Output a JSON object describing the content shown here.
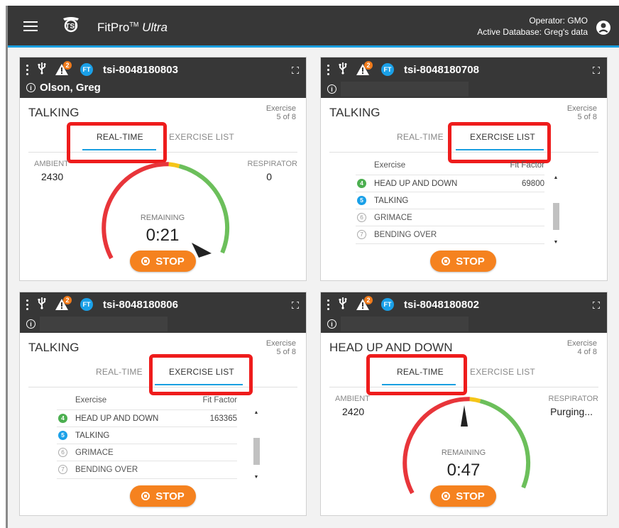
{
  "app": {
    "title": "FitPro",
    "tm": "TM",
    "edition": "Ultra",
    "operator_line": "Operator: GMO",
    "database_line": "Active Database: Greg's data"
  },
  "cards": [
    {
      "device": "tsi-8048180803",
      "alert_count": "2",
      "ft_label": "FT",
      "person": "Olson, Greg",
      "exercise": "TALKING",
      "exercise_label": "Exercise",
      "exercise_count": "5 of 8",
      "tab_realtime": "REAL-TIME",
      "tab_list": "EXERCISE LIST",
      "active_tab": "REAL-TIME",
      "ambient_label": "AMBIENT",
      "ambient": "2430",
      "respirator_label": "RESPIRATOR",
      "respirator": "0",
      "remaining_label": "REMAINING",
      "remaining": "0:21",
      "stop_label": "STOP"
    },
    {
      "device": "tsi-8048180708",
      "alert_count": "2",
      "ft_label": "FT",
      "person": "",
      "exercise": "TALKING",
      "exercise_label": "Exercise",
      "exercise_count": "5 of 8",
      "tab_realtime": "REAL-TIME",
      "tab_list": "EXERCISE LIST",
      "active_tab": "EXERCISE LIST",
      "list_col_exercise": "Exercise",
      "list_col_fit": "Fit Factor",
      "list": [
        {
          "n": "4",
          "name": "HEAD UP AND DOWN",
          "fit": "69800",
          "state": "done"
        },
        {
          "n": "5",
          "name": "TALKING",
          "fit": "",
          "state": "current"
        },
        {
          "n": "6",
          "name": "GRIMACE",
          "fit": "",
          "state": "pending"
        },
        {
          "n": "7",
          "name": "BENDING OVER",
          "fit": "",
          "state": "pending"
        }
      ],
      "stop_label": "STOP"
    },
    {
      "device": "tsi-8048180806",
      "alert_count": "2",
      "ft_label": "FT",
      "person": "",
      "exercise": "TALKING",
      "exercise_label": "Exercise",
      "exercise_count": "5 of 8",
      "tab_realtime": "REAL-TIME",
      "tab_list": "EXERCISE LIST",
      "active_tab": "EXERCISE LIST",
      "list_col_exercise": "Exercise",
      "list_col_fit": "Fit Factor",
      "list": [
        {
          "n": "4",
          "name": "HEAD UP AND DOWN",
          "fit": "163365",
          "state": "done"
        },
        {
          "n": "5",
          "name": "TALKING",
          "fit": "",
          "state": "current"
        },
        {
          "n": "6",
          "name": "GRIMACE",
          "fit": "",
          "state": "pending"
        },
        {
          "n": "7",
          "name": "BENDING OVER",
          "fit": "",
          "state": "pending"
        }
      ],
      "stop_label": "STOP"
    },
    {
      "device": "tsi-8048180802",
      "alert_count": "2",
      "ft_label": "FT",
      "person": "",
      "exercise": "HEAD UP AND DOWN",
      "exercise_label": "Exercise",
      "exercise_count": "4 of 8",
      "tab_realtime": "REAL-TIME",
      "tab_list": "EXERCISE LIST",
      "active_tab": "REAL-TIME",
      "ambient_label": "AMBIENT",
      "ambient": "2420",
      "respirator_label": "RESPIRATOR",
      "respirator": "Purging...",
      "remaining_label": "REMAINING",
      "remaining": "0:47",
      "stop_label": "STOP"
    }
  ],
  "colors": {
    "appbar": "#373737",
    "accent_blue": "#1a9fe0",
    "stop_orange": "#f5821f",
    "gauge_red": "#e8353a",
    "gauge_yellow": "#f5c518",
    "gauge_green": "#6cbf5b",
    "highlight_red": "#ee1c1c"
  }
}
